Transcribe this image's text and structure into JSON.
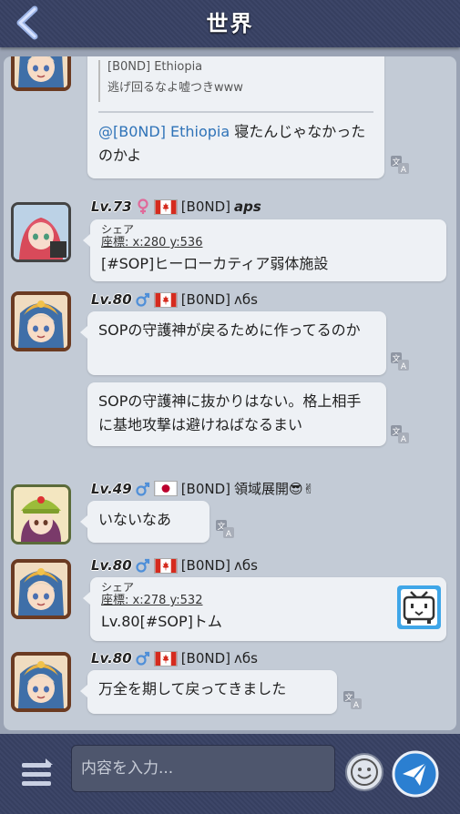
{
  "header": {
    "title": "世界"
  },
  "messages": {
    "m0": {
      "quote_lines": [
        "[B0ND] Ethiopia",
        "逃げ回るなよ嘘つきwww"
      ],
      "mention": "@[B0ND] Ethiopia",
      "text_after_mention": " 寝たんじゃなかったのかよ"
    },
    "m1": {
      "level": "Lv.73",
      "gender": "female",
      "flag": "canada",
      "name": "[B0ND]",
      "name2": "aps",
      "share_label": "シェア",
      "share_coord": "座標: x:280 y:536",
      "text": "[#SOP]ヒーローカティア弱体施設"
    },
    "m2": {
      "level": "Lv.80",
      "gender": "male",
      "flag": "canada",
      "name": "[B0ND]",
      "name2": "ʌбs",
      "text1": "SOPの守護神が戻るために作ってるのか",
      "text2": "SOPの守護神に抜かりはない。格上相手に基地攻撃は避けねばなるまい"
    },
    "m3": {
      "level": "Lv.49",
      "gender": "male",
      "flag": "japan",
      "name": "[B0ND]",
      "name2": "領域展開😎✌",
      "text": "いないなあ"
    },
    "m4": {
      "level": "Lv.80",
      "gender": "male",
      "flag": "canada",
      "name": "[B0ND]",
      "name2": "ʌбs",
      "share_label": "シェア",
      "share_coord": "座標: x:278 y:532",
      "text": "Lv.80[#SOP]トム"
    },
    "m5": {
      "level": "Lv.80",
      "gender": "male",
      "flag": "canada",
      "name": "[B0ND]",
      "name2": "ʌбs",
      "text": "万全を期して戻ってきました"
    }
  },
  "input": {
    "placeholder": "内容を入力..."
  },
  "icons": {
    "back": "back-arrow-icon",
    "translate": "translate-icon",
    "menu": "menu-toggle-icon",
    "emoji": "emoji-icon",
    "send": "send-icon",
    "tv": "tv-mascot-icon"
  },
  "colors": {
    "header": "#3a4364",
    "panel": "#c3cbd6",
    "bubble": "#eef1f5",
    "mention": "#2f73b8",
    "send": "#2b7fd1"
  }
}
